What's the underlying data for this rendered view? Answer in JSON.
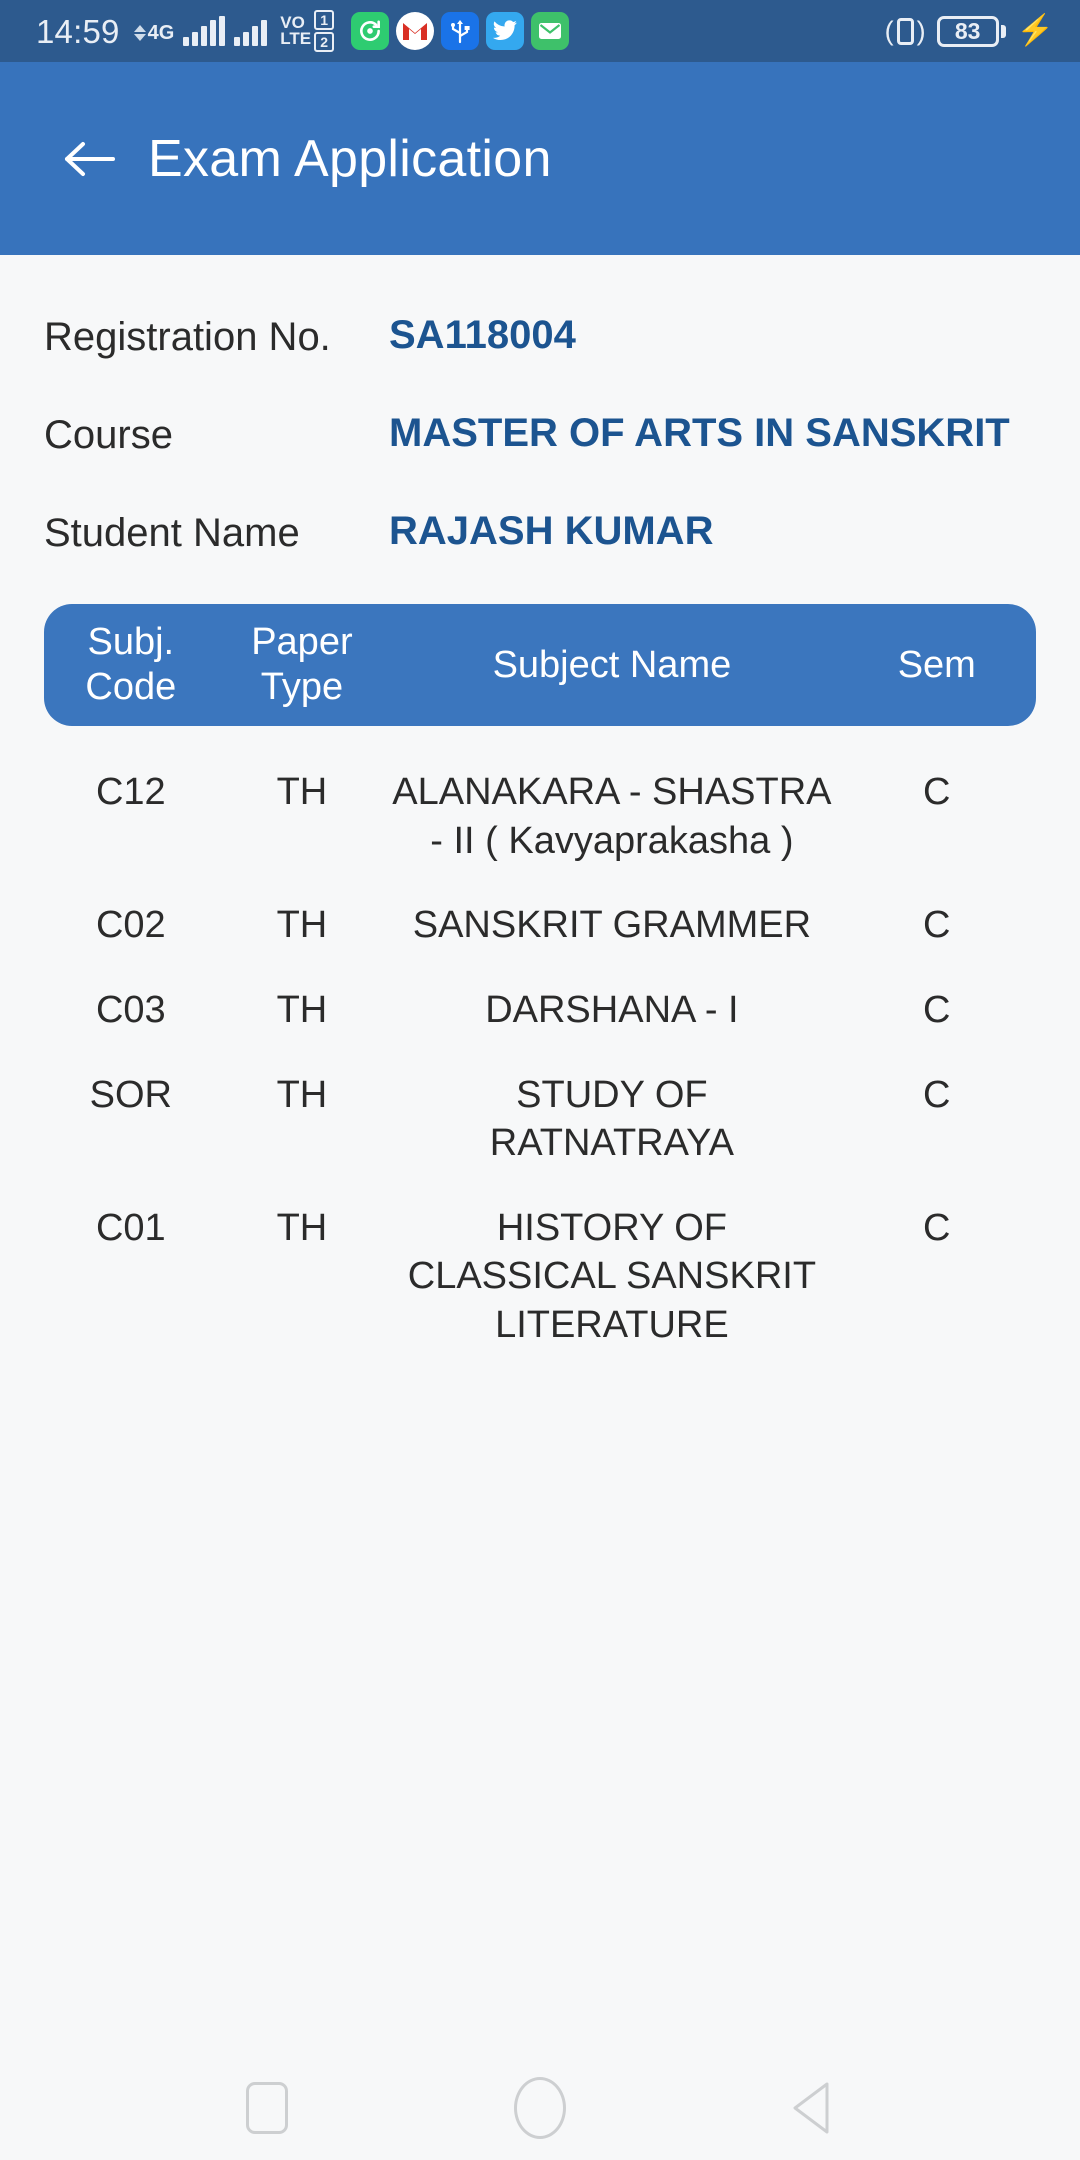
{
  "status_bar": {
    "time": "14:59",
    "network_generation": "4G",
    "volte_line1": "VO",
    "volte_line2": "LTE",
    "sim_badge_1": "1",
    "sim_badge_2": "2",
    "notification_icons": [
      "sync-icon",
      "gmail-icon",
      "usb-icon",
      "twitter-icon",
      "email-icon"
    ],
    "vibrate_icon": "vibrate-icon",
    "battery_percent": "83",
    "charging_icon": "charging-bolt-icon"
  },
  "app_bar": {
    "back_icon": "back-arrow-icon",
    "title": "Exam Application"
  },
  "info": {
    "rows": [
      {
        "label": "Registration No.",
        "value": "SA118004"
      },
      {
        "label": "Course",
        "value": "MASTER OF ARTS IN SANSKRIT"
      },
      {
        "label": "Student Name",
        "value": "RAJASH KUMAR"
      }
    ]
  },
  "table": {
    "headers": {
      "subject_code": "Subj. Code",
      "paper_type": "Paper Type",
      "subject_name": "Subject Name",
      "sem": "Sem"
    },
    "rows": [
      {
        "subject_code": "C12",
        "paper_type": "TH",
        "subject_name": "ALANAKARA - SHASTRA - II ( Kavyaprakasha )",
        "sem": "C"
      },
      {
        "subject_code": "C02",
        "paper_type": "TH",
        "subject_name": "SANSKRIT GRAMMER",
        "sem": "C"
      },
      {
        "subject_code": "C03",
        "paper_type": "TH",
        "subject_name": "DARSHANA - I",
        "sem": "C"
      },
      {
        "subject_code": "SOR",
        "paper_type": "TH",
        "subject_name": "STUDY OF RATNATRAYA",
        "sem": "C"
      },
      {
        "subject_code": "C01",
        "paper_type": "TH",
        "subject_name": "HISTORY OF CLASSICAL SANSKRIT LITERATURE",
        "sem": "C"
      }
    ]
  },
  "nav_bar": {
    "recents_icon": "square-recents-icon",
    "home_icon": "circle-home-icon",
    "back_icon": "triangle-back-icon"
  },
  "colors": {
    "status_bar_bg": "#2d5a8e",
    "app_bar_bg": "#3773bc",
    "table_header_bg": "#3b76be",
    "value_text": "#1c5490",
    "page_bg": "#f7f8f9"
  }
}
